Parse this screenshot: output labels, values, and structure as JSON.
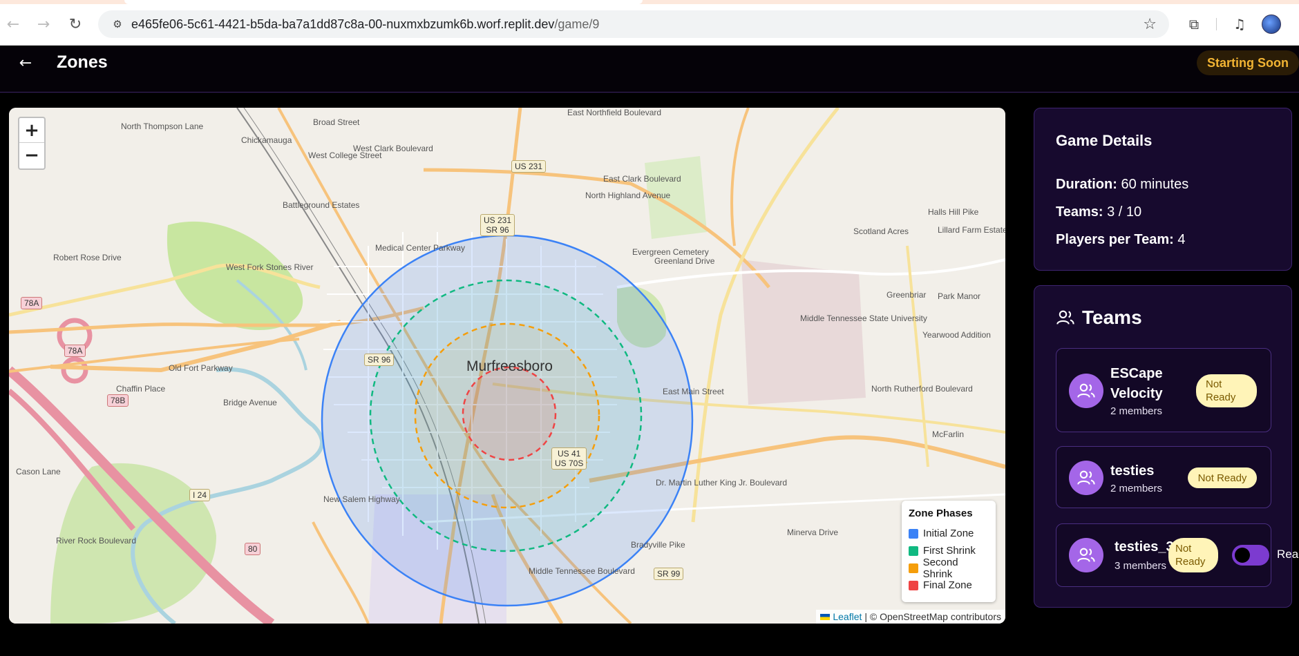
{
  "browser": {
    "url_host": "e465fe06-5c61-4421-b5da-ba7a1dd87c8a-00-nuxmxbzumk6b.worf.replit.dev",
    "url_path": "/game/9"
  },
  "header": {
    "title": "Zones",
    "status": "Starting Soon"
  },
  "map": {
    "zoom_in": "+",
    "zoom_out": "−",
    "city_label": "Murfreesboro",
    "labels": [
      "West Clark Boulevard",
      "East Clark Boulevard",
      "Medical Center Parkway",
      "Battleground Estates",
      "West Fork Stones River",
      "Old Fort Parkway",
      "Bridge Avenue",
      "Robert Rose Drive",
      "Chaffin Place",
      "North Thompson Lane",
      "West College Street",
      "Evergreen Cemetery",
      "Greenland Drive",
      "Scotland Acres",
      "Lillard Farm Estates",
      "Halls Hill Pike",
      "Park Manor",
      "Greenbriar",
      "Middle Tennessee State University",
      "Yearwood Addition",
      "McFarlin",
      "East Main Street",
      "Dr. Martin Luther King Jr. Boulevard",
      "Middle Tennessee Boulevard",
      "Bradyville Pike",
      "Minerva Drive",
      "River Rock Boulevard",
      "Cason Lane",
      "New Salem Highway",
      "North Highland Avenue",
      "North Rutherford Boulevard",
      "East Northfield Boulevard",
      "Broad Street",
      "Chickamauga"
    ],
    "shields": {
      "us231_top": "US 231",
      "us231_sr96": [
        "US 231",
        "SR 96"
      ],
      "sr96": "SR 96",
      "us41": [
        "US 41",
        "US 70S"
      ],
      "sr99": "SR 99",
      "i24": "I 24",
      "r78a": "78A",
      "r78b": "78B",
      "r80": "80"
    },
    "legend": {
      "title": "Zone Phases",
      "items": [
        {
          "label": "Initial Zone",
          "color": "#3b82f6"
        },
        {
          "label": "First Shrink",
          "color": "#10b981"
        },
        {
          "label": "Second Shrink",
          "color": "#f59e0b"
        },
        {
          "label": "Final Zone",
          "color": "#ef4444"
        }
      ]
    },
    "attribution": {
      "leaflet": "Leaflet",
      "rest": "| © OpenStreetMap contributors"
    }
  },
  "game_details": {
    "title": "Game Details",
    "duration_label": "Duration:",
    "duration_value": "60 minutes",
    "teams_label": "Teams:",
    "teams_value": "3 / 10",
    "players_label": "Players per Team:",
    "players_value": "4"
  },
  "teams": {
    "title": "Teams",
    "items": [
      {
        "name": "ESCape Velocity",
        "members": "2 members",
        "status": "Not Ready"
      },
      {
        "name": "testies",
        "members": "2 members",
        "status": "Not Ready"
      },
      {
        "name": "testies_3",
        "members": "3 members",
        "status": "Not Ready",
        "ready_label": "Ready"
      }
    ]
  }
}
